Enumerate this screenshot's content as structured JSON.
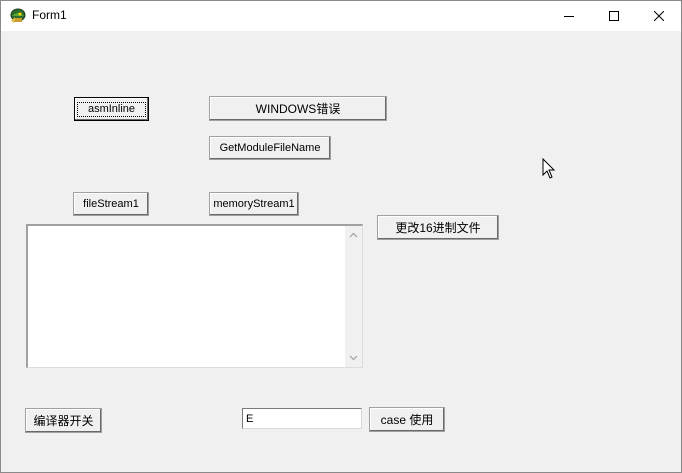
{
  "window": {
    "title": "Form1",
    "app_icon": "delphi-helmet-icon",
    "caption_icons": [
      "minimize-icon",
      "maximize-icon",
      "close-icon"
    ]
  },
  "buttons": {
    "asm_inline": "asmInline",
    "windows_error": "WINDOWS错误",
    "get_module_file_name": "GetModuleFileName",
    "file_stream": "fileStream1",
    "memory_stream": "memoryStream1",
    "modify_hex_file": "更改16进制文件",
    "compiler_switch": "编译器开关",
    "case_use": "case 使用"
  },
  "memo": {
    "value": ""
  },
  "edit": {
    "value": "E"
  }
}
